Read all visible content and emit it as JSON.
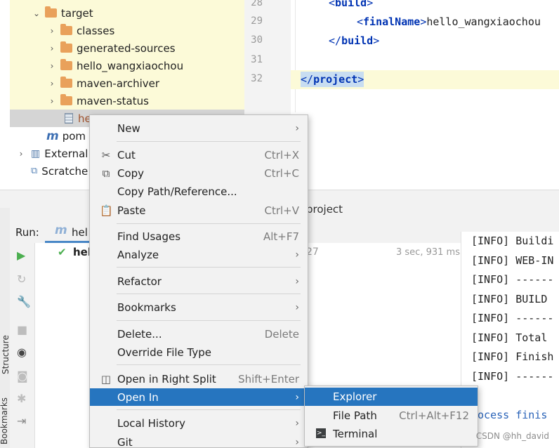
{
  "project_tree": {
    "items": [
      {
        "label": "target",
        "expanded": true
      },
      {
        "label": "classes"
      },
      {
        "label": "generated-sources"
      },
      {
        "label": "hello_wangxiaochou"
      },
      {
        "label": "maven-archiver"
      },
      {
        "label": "maven-status"
      },
      {
        "label": "he"
      },
      {
        "label": "pom"
      },
      {
        "label": "External"
      },
      {
        "label": "Scratche"
      }
    ]
  },
  "editor": {
    "line_numbers": [
      "28",
      "29",
      "30",
      "31",
      "32"
    ],
    "lines": {
      "l28_open": "<",
      "l28_name": "build",
      "l28_close": ">",
      "l29_open": "<",
      "l29_name": "finalName",
      "l29_close": ">",
      "l29_text": "hello_wangxiaochou",
      "l30_open": "</",
      "l30_name": "build",
      "l30_close": ">",
      "l32_open": "</",
      "l32_name": "project",
      "l32_close": ">"
    }
  },
  "tool_window": {
    "title_fragment": "project"
  },
  "run_panel": {
    "label": "Run:",
    "tab_label": "hel",
    "tree_item": "hel",
    "tree_item_suffix": "27",
    "duration": "3 sec, 931 ms"
  },
  "side_tabs": {
    "structure": "Structure",
    "bookmarks": "Bookmarks"
  },
  "console": {
    "lines": [
      "[INFO] Buildi",
      "[INFO] WEB-IN",
      "[INFO] ------",
      "[INFO] BUILD",
      "[INFO] ------",
      "[INFO] Total",
      "[INFO] Finish",
      "[INFO] ------",
      "rocess finis"
    ]
  },
  "context_menu": {
    "new": "New",
    "cut": "Cut",
    "cut_shortcut": "Ctrl+X",
    "copy": "Copy",
    "copy_shortcut": "Ctrl+C",
    "copy_path": "Copy Path/Reference...",
    "paste": "Paste",
    "paste_shortcut": "Ctrl+V",
    "find_usages": "Find Usages",
    "find_usages_shortcut": "Alt+F7",
    "analyze": "Analyze",
    "refactor": "Refactor",
    "bookmarks": "Bookmarks",
    "delete": "Delete...",
    "delete_shortcut": "Delete",
    "override_file_type": "Override File Type",
    "open_right_split": "Open in Right Split",
    "open_right_split_shortcut": "Shift+Enter",
    "open_in": "Open In",
    "local_history": "Local History",
    "git": "Git"
  },
  "submenu": {
    "explorer": "Explorer",
    "file_path": "File Path",
    "file_path_shortcut": "Ctrl+Alt+F12",
    "terminal": "Terminal"
  },
  "watermark": "CSDN @hh_david",
  "colors": {
    "selection": "#2675bf",
    "folder": "#e9a15b",
    "xml_tag": "#0033b3",
    "highlight_row": "#fcfad8"
  }
}
